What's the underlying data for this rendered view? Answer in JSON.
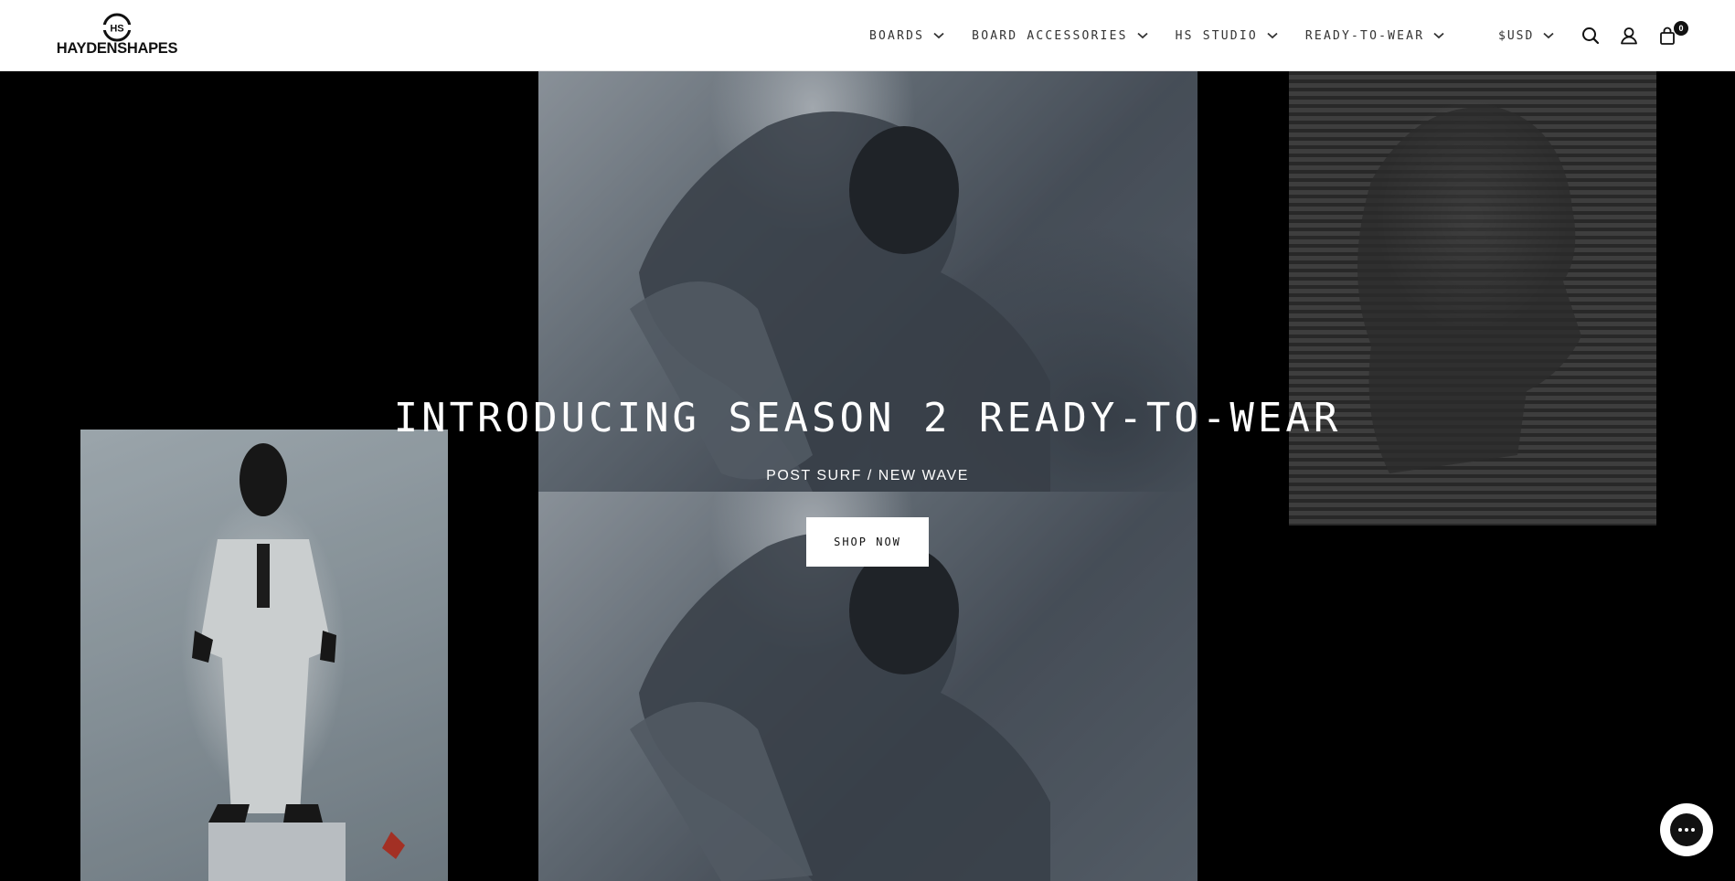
{
  "header": {
    "logo_text": "HAYDENSHAPES",
    "nav": [
      {
        "label": "BOARDS"
      },
      {
        "label": "BOARD ACCESSORIES"
      },
      {
        "label": "HS STUDIO"
      },
      {
        "label": "READY-TO-WEAR"
      }
    ],
    "currency": "$USD",
    "cart_count": "0",
    "icons": [
      "search-icon",
      "account-icon",
      "cart-icon"
    ]
  },
  "hero": {
    "title": "INTRODUCING SEASON 2 READY-TO-WEAR",
    "subtitle": "POST SURF / NEW WAVE",
    "cta_label": "SHOP NOW"
  },
  "chat": {
    "icon": "chat-icon"
  },
  "colors": {
    "header_bg": "#ffffff",
    "hero_bg": "#000000",
    "text_light": "#ffffff"
  }
}
